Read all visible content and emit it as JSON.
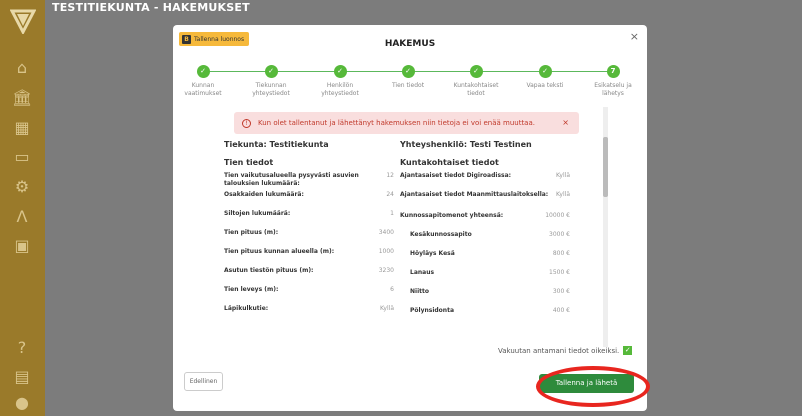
{
  "app": {
    "title": "TESTITIEKUNTA - HAKEMUKSET"
  },
  "sidebar": {
    "icons": [
      "logo-icon",
      "home-icon",
      "bank-icon",
      "calendar-icon",
      "folder-icon",
      "gear-icon",
      "road-icon",
      "document-icon",
      "help-icon",
      "id-card-icon",
      "user-icon"
    ]
  },
  "modal": {
    "save_draft_label": "Tallenna luonnos",
    "title": "HAKEMUS",
    "close_label": "×",
    "steps": [
      {
        "label": "Kunnan vaatimukset"
      },
      {
        "label": "Tiekunnan yhteystiedot"
      },
      {
        "label": "Henkilön yhteystiedot"
      },
      {
        "label": "Tien tiedot"
      },
      {
        "label": "Kuntakohtaiset tiedot"
      },
      {
        "label": "Vapaa teksti"
      },
      {
        "label": "Esikatselu ja lähetys"
      }
    ],
    "alert_text": "Kun olet tallentanut ja lähettänyt hakemuksen niin tietoja ei voi enää muuttaa.",
    "alert_close": "×",
    "left": {
      "header": "Tiekunta: Testitiekunta",
      "section": "Tien tiedot",
      "rows": [
        {
          "k": "Tien vaikutusalueella pysyvästi asuvien talouksien lukumäärä:",
          "v": "12"
        },
        {
          "k": "Osakkaiden lukumäärä:",
          "v": "24"
        },
        {
          "k": "Siltojen lukumäärä:",
          "v": "1"
        },
        {
          "k": "Tien pituus (m):",
          "v": "3400"
        },
        {
          "k": "Tien pituus kunnan alueella (m):",
          "v": "1000"
        },
        {
          "k": "Asutun tiestön pituus (m):",
          "v": "3230"
        },
        {
          "k": "Tien leveys (m):",
          "v": "6"
        },
        {
          "k": "Läpikulkutie:",
          "v": "Kyllä"
        }
      ]
    },
    "right": {
      "header": "Yhteyshenkilö: Testi Testinen",
      "section": "Kuntakohtaiset tiedot",
      "rows": [
        {
          "k": "Ajantasaiset tiedot Digiroadissa:",
          "v": "Kyllä"
        },
        {
          "k": "Ajantasaiset tiedot Maanmittauslaitoksella:",
          "v": "Kyllä"
        },
        {
          "k": "Kunnossapitomenot yhteensä:",
          "v": "10000 €"
        },
        {
          "k": "Kesäkunnossapito",
          "v": "3000 €"
        },
        {
          "k": "Höyläys Kesä",
          "v": "800 €"
        },
        {
          "k": "Lanaus",
          "v": "1500 €"
        },
        {
          "k": "Niitto",
          "v": "300 €"
        },
        {
          "k": "Pölynsidonta",
          "v": "400 €"
        }
      ]
    },
    "confirm_label": "Vakuutan antamani tiedot oikeiksi.",
    "prev_label": "Edellinen",
    "submit_label": "Tallenna ja lähetä"
  }
}
